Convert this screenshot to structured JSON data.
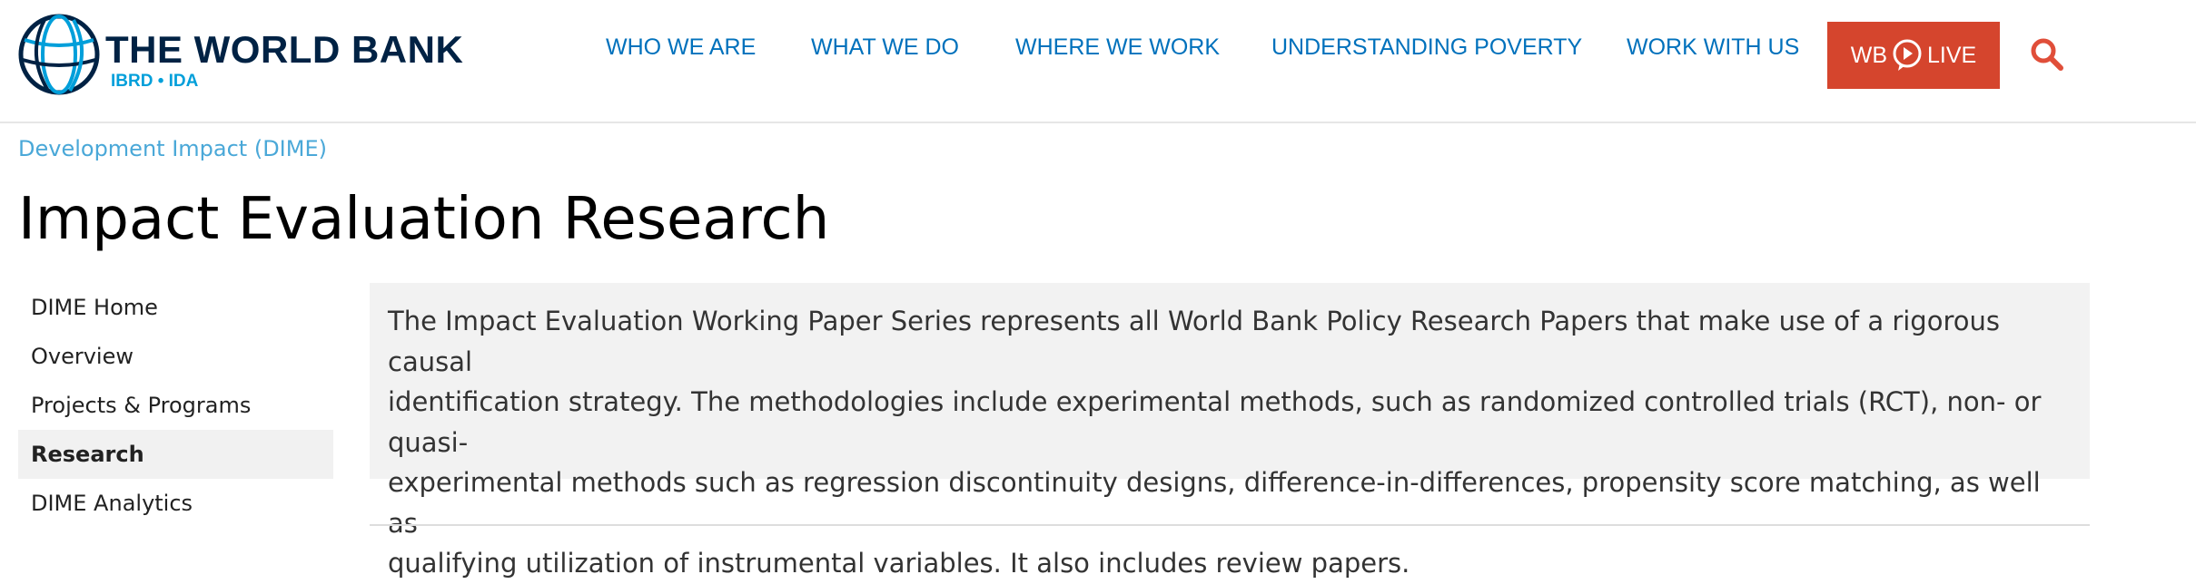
{
  "header": {
    "logo": {
      "title": "THE WORLD BANK",
      "subtitle": "IBRD • IDA"
    },
    "nav": [
      {
        "label": "WHO WE ARE"
      },
      {
        "label": "WHAT WE DO"
      },
      {
        "label": "WHERE WE WORK"
      },
      {
        "label": "UNDERSTANDING POVERTY"
      },
      {
        "label": "WORK WITH US"
      }
    ],
    "live_button": {
      "left": "WB",
      "right": "LIVE"
    },
    "colors": {
      "brand_navy": "#002244",
      "nav_blue": "#0071bc",
      "live_red": "#d5452d",
      "search_orange": "#e04e39"
    }
  },
  "breadcrumb": "Development Impact (DIME)",
  "page_title": "Impact Evaluation Research",
  "sidebar": {
    "items": [
      {
        "label": "DIME Home",
        "active": false
      },
      {
        "label": "Overview",
        "active": false
      },
      {
        "label": "Projects & Programs",
        "active": false
      },
      {
        "label": "Research",
        "active": true
      },
      {
        "label": "DIME Analytics",
        "active": false
      }
    ]
  },
  "intro": {
    "lines": [
      "The Impact Evaluation Working Paper Series represents all World Bank Policy Research Papers that make use of a rigorous causal",
      "identification strategy. The methodologies include experimental methods, such as randomized controlled trials (RCT), non- or quasi-",
      "experimental methods such as regression discontinuity designs, difference-in-differences, propensity score matching, as well as",
      "qualifying utilization of instrumental variables. It also includes review papers."
    ]
  }
}
